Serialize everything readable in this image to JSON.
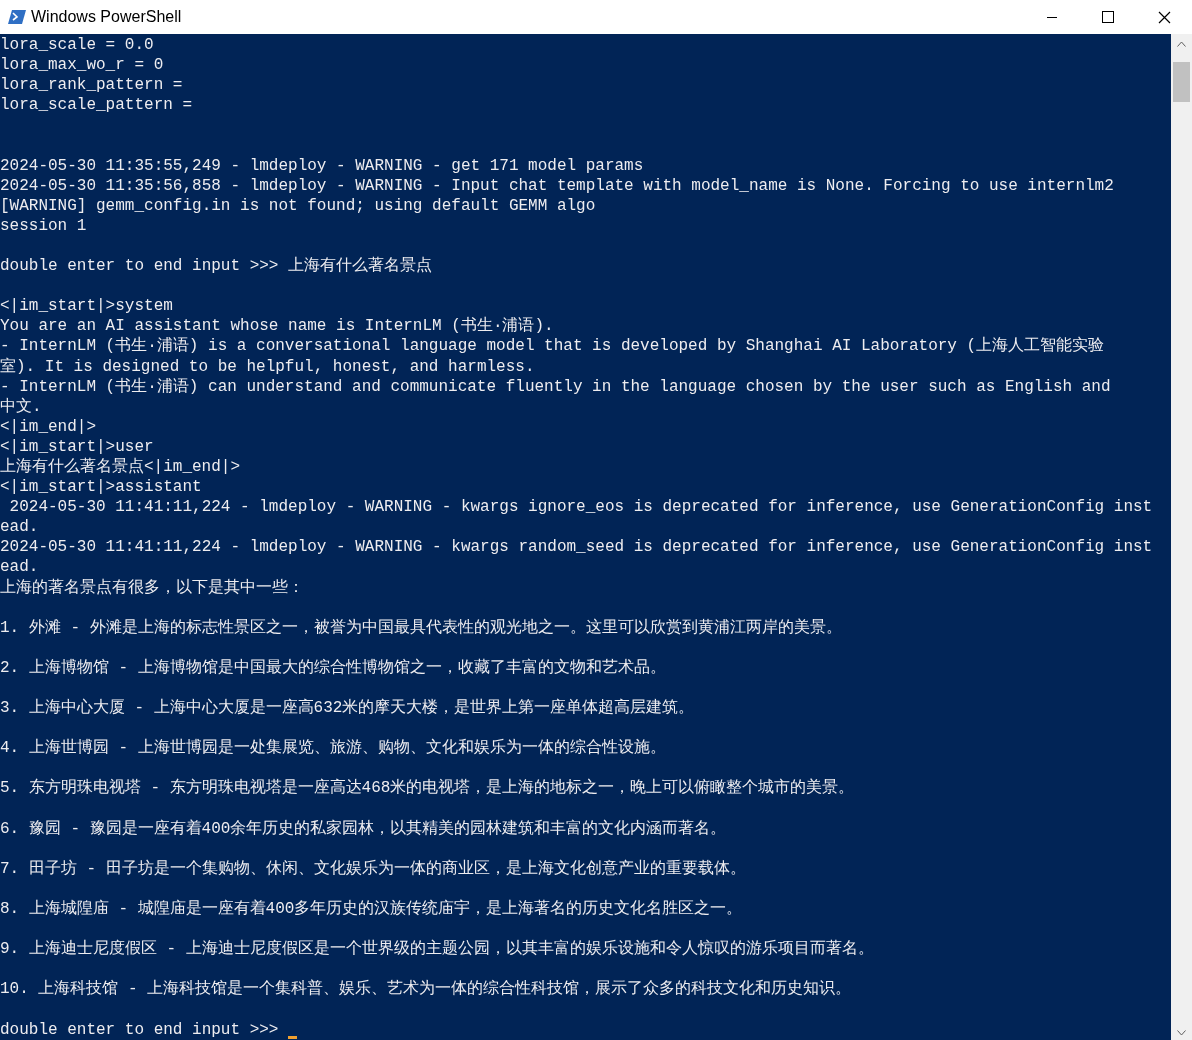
{
  "window": {
    "title": "Windows PowerShell"
  },
  "console": {
    "lines": [
      {
        "kind": "line",
        "text": "lora_scale = 0.0"
      },
      {
        "kind": "line",
        "text": "lora_max_wo_r = 0"
      },
      {
        "kind": "line",
        "text": "lora_rank_pattern ="
      },
      {
        "kind": "line",
        "text": "lora_scale_pattern ="
      },
      {
        "kind": "blank"
      },
      {
        "kind": "blank"
      },
      {
        "kind": "line",
        "text": "2024-05-30 11:35:55,249 - lmdeploy - WARNING - get 171 model params"
      },
      {
        "kind": "line",
        "text": "2024-05-30 11:35:56,858 - lmdeploy - WARNING - Input chat template with model_name is None. Forcing to use internlm2"
      },
      {
        "kind": "line",
        "text": "[WARNING] gemm_config.in is not found; using default GEMM algo"
      },
      {
        "kind": "line",
        "text": "session 1"
      },
      {
        "kind": "blank"
      },
      {
        "kind": "line",
        "text": "double enter to end input >>> 上海有什么著名景点"
      },
      {
        "kind": "blank"
      },
      {
        "kind": "line",
        "text": "<|im_start|>system"
      },
      {
        "kind": "line",
        "text": "You are an AI assistant whose name is InternLM (书生·浦语)."
      },
      {
        "kind": "line",
        "text": "- InternLM (书生·浦语) is a conversational language model that is developed by Shanghai AI Laboratory (上海人工智能实验"
      },
      {
        "kind": "line",
        "text": "室). It is designed to be helpful, honest, and harmless."
      },
      {
        "kind": "line",
        "text": "- InternLM (书生·浦语) can understand and communicate fluently in the language chosen by the user such as English and"
      },
      {
        "kind": "line",
        "text": "中文."
      },
      {
        "kind": "line",
        "text": "<|im_end|>"
      },
      {
        "kind": "line",
        "text": "<|im_start|>user"
      },
      {
        "kind": "line",
        "text": "上海有什么著名景点<|im_end|>"
      },
      {
        "kind": "line",
        "text": "<|im_start|>assistant"
      },
      {
        "kind": "line",
        "text": " 2024-05-30 11:41:11,224 - lmdeploy - WARNING - kwargs ignore_eos is deprecated for inference, use GenerationConfig inst"
      },
      {
        "kind": "line",
        "text": "ead."
      },
      {
        "kind": "line",
        "text": "2024-05-30 11:41:11,224 - lmdeploy - WARNING - kwargs random_seed is deprecated for inference, use GenerationConfig inst"
      },
      {
        "kind": "line",
        "text": "ead."
      },
      {
        "kind": "line",
        "text": "上海的著名景点有很多，以下是其中一些："
      },
      {
        "kind": "blank"
      },
      {
        "kind": "line",
        "text": "1. 外滩 - 外滩是上海的标志性景区之一，被誉为中国最具代表性的观光地之一。这里可以欣赏到黄浦江两岸的美景。"
      },
      {
        "kind": "blank"
      },
      {
        "kind": "line",
        "text": "2. 上海博物馆 - 上海博物馆是中国最大的综合性博物馆之一，收藏了丰富的文物和艺术品。"
      },
      {
        "kind": "blank"
      },
      {
        "kind": "line",
        "text": "3. 上海中心大厦 - 上海中心大厦是一座高632米的摩天大楼，是世界上第一座单体超高层建筑。"
      },
      {
        "kind": "blank"
      },
      {
        "kind": "line",
        "text": "4. 上海世博园 - 上海世博园是一处集展览、旅游、购物、文化和娱乐为一体的综合性设施。"
      },
      {
        "kind": "blank"
      },
      {
        "kind": "line",
        "text": "5. 东方明珠电视塔 - 东方明珠电视塔是一座高达468米的电视塔，是上海的地标之一，晚上可以俯瞰整个城市的美景。"
      },
      {
        "kind": "blank"
      },
      {
        "kind": "line",
        "text": "6. 豫园 - 豫园是一座有着400余年历史的私家园林，以其精美的园林建筑和丰富的文化内涵而著名。"
      },
      {
        "kind": "blank"
      },
      {
        "kind": "line",
        "text": "7. 田子坊 - 田子坊是一个集购物、休闲、文化娱乐为一体的商业区，是上海文化创意产业的重要载体。"
      },
      {
        "kind": "blank"
      },
      {
        "kind": "line",
        "text": "8. 上海城隍庙 - 城隍庙是一座有着400多年历史的汉族传统庙宇，是上海著名的历史文化名胜区之一。"
      },
      {
        "kind": "blank"
      },
      {
        "kind": "line",
        "text": "9. 上海迪士尼度假区 - 上海迪士尼度假区是一个世界级的主题公园，以其丰富的娱乐设施和令人惊叹的游乐项目而著名。"
      },
      {
        "kind": "blank"
      },
      {
        "kind": "line",
        "text": "10. 上海科技馆 - 上海科技馆是一个集科普、娱乐、艺术为一体的综合性科技馆，展示了众多的科技文化和历史知识。"
      },
      {
        "kind": "blank"
      }
    ],
    "prompt": {
      "text": "double enter to end input >>>",
      "cursor": true
    }
  }
}
